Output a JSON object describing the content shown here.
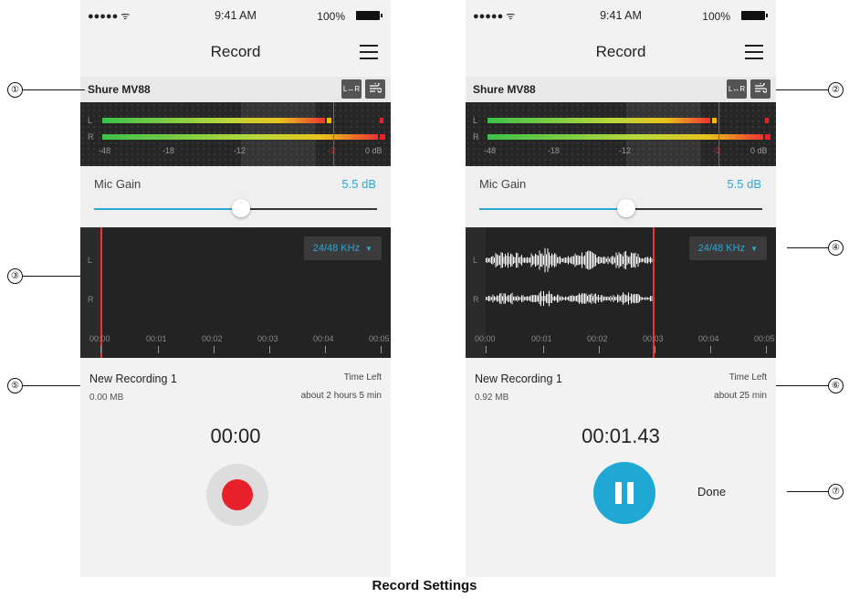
{
  "status_bar": {
    "signal": "●●●●● ᯤ",
    "time": "9:41 AM",
    "battery": "100%"
  },
  "nav": {
    "title": "Record"
  },
  "device": {
    "name": "Shure MV88",
    "lr_label": "L↔R"
  },
  "meter": {
    "channels": [
      "L",
      "R"
    ],
    "ticks": [
      "-48",
      "-18",
      "-12",
      "-3",
      "0 dB"
    ]
  },
  "gain": {
    "label": "Mic Gain",
    "value": "5.5 dB",
    "level": 0.5
  },
  "waveform": {
    "channels": [
      "L",
      "R"
    ],
    "sample_rate": "24/48 KHz",
    "time_labels": [
      "00:00",
      "00:01",
      "00:02",
      "00:03",
      "00:04",
      "00:05"
    ]
  },
  "left_screen": {
    "recording_name": "New Recording 1",
    "file_size": "0.00 MB",
    "time_left_label": "Time Left",
    "time_left_value": "about 2 hours 5 min",
    "timer": "00:00"
  },
  "right_screen": {
    "recording_name": "New Recording 1",
    "file_size": "0.92 MB",
    "time_left_label": "Time Left",
    "time_left_value": "about 25 min",
    "timer": "00:01.43",
    "done_label": "Done"
  },
  "callouts": [
    "①",
    "②",
    "③",
    "④",
    "⑤",
    "⑥",
    "⑦"
  ],
  "caption": "Record Settings",
  "colors": {
    "accent": "#29a8d6",
    "record": "#e8202a",
    "playhead": "#e33333"
  }
}
